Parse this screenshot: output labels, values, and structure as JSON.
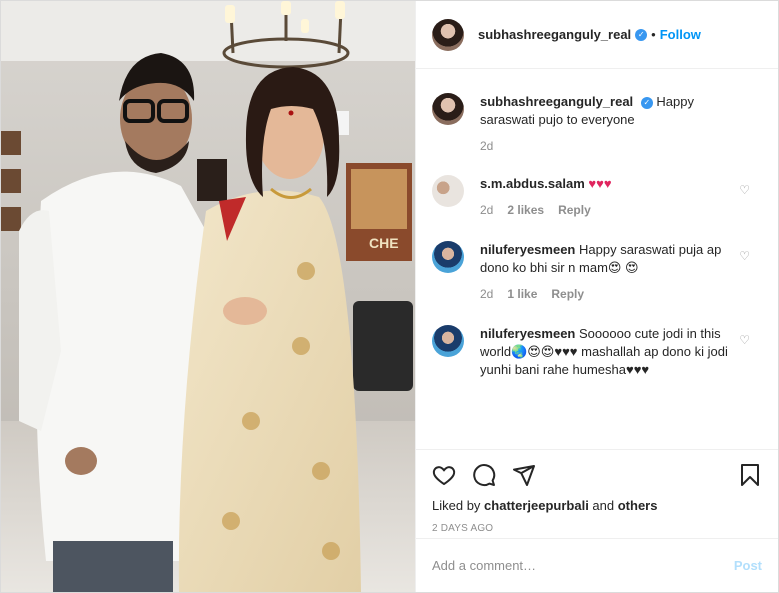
{
  "post": {
    "author": "subhashreeganguly_real",
    "follow_label": "Follow",
    "dot": "•"
  },
  "caption": {
    "author": "subhashreeganguly_real",
    "text": "Happy saraswati pujo to everyone",
    "time": "2d"
  },
  "comments": [
    {
      "user": "s.m.abdus.salam",
      "text": "♥♥♥",
      "time": "2d",
      "likes": "2 likes",
      "reply": "Reply"
    },
    {
      "user": "niluferyesmeen",
      "text": "Happy saraswati puja ap dono ko bhi sir n mam😍 😍",
      "time": "2d",
      "likes": "1 like",
      "reply": "Reply"
    },
    {
      "user": "niluferyesmeen",
      "text": "Soooooo cute jodi in this world🌏😍😍♥♥♥ mashallah ap dono ki jodi yunhi bani rahe humesha♥♥♥"
    }
  ],
  "likes": {
    "prefix": "Liked by ",
    "user": "chatterjeepurbali",
    "mid": " and ",
    "others": "others"
  },
  "date": "2 DAYS AGO",
  "add_comment": {
    "placeholder": "Add a comment…",
    "post_label": "Post"
  },
  "colors": {
    "accent": "#0095f6",
    "verified": "#3897f0",
    "muted": "#8e8e8e"
  }
}
